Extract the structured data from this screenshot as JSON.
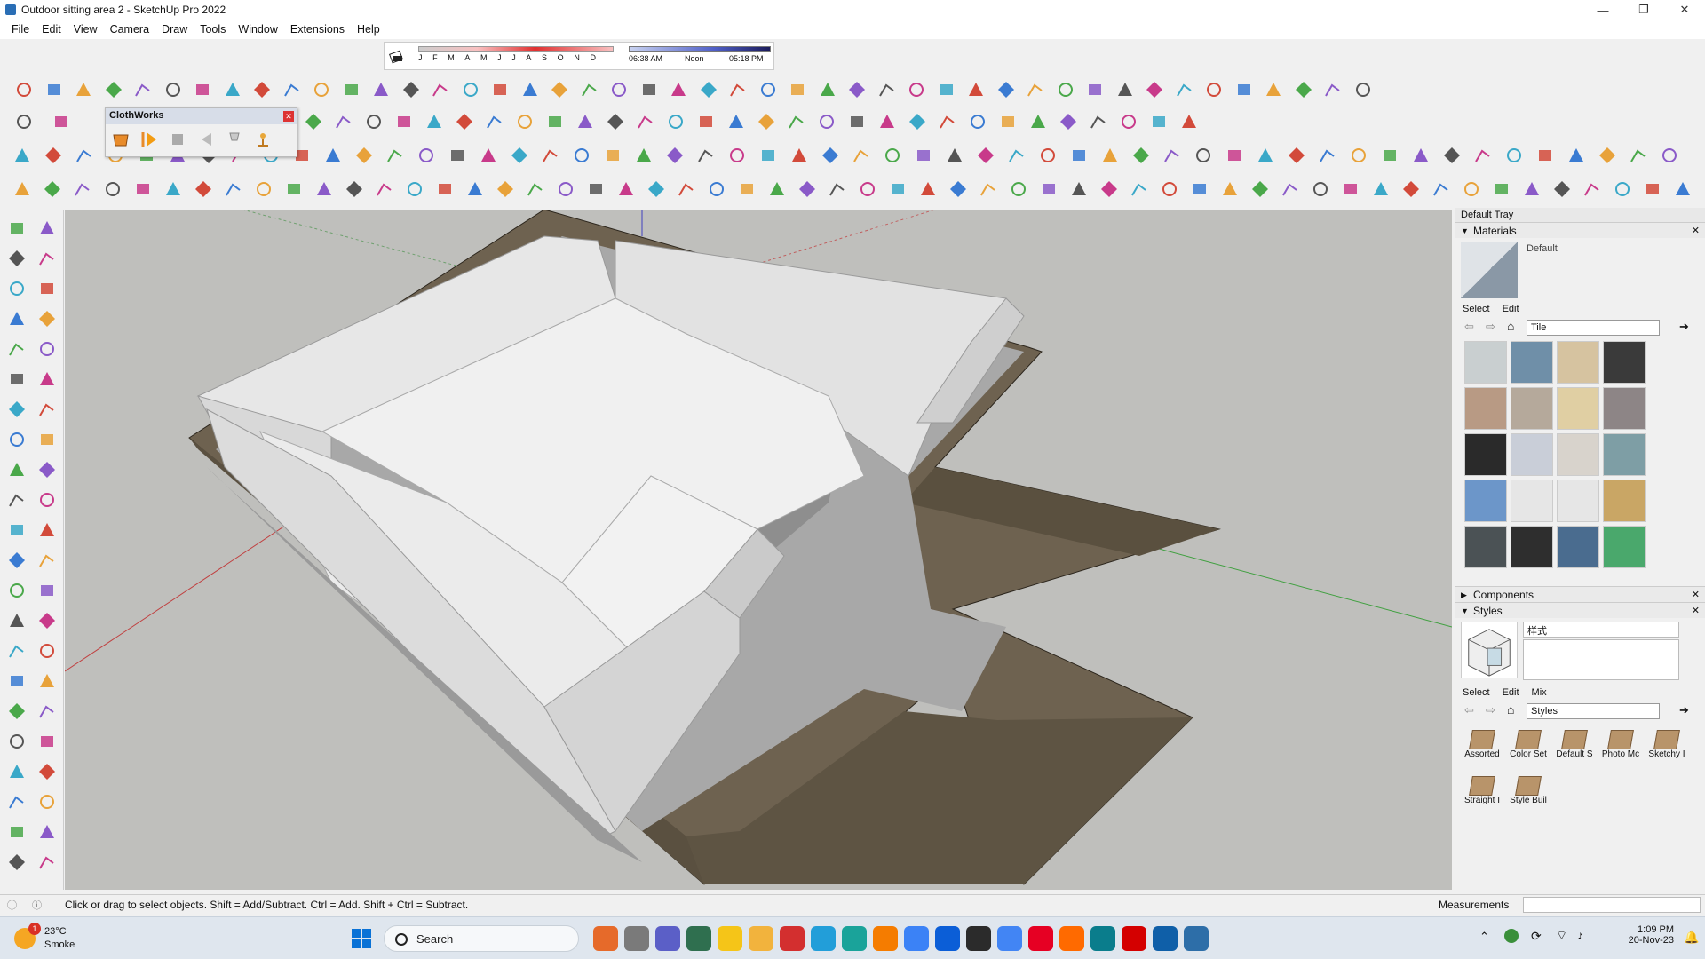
{
  "window": {
    "title": "Outdoor sitting area 2 - SketchUp Pro 2022",
    "controls": [
      "—",
      "❐",
      "✕"
    ]
  },
  "menu": [
    "File",
    "Edit",
    "View",
    "Camera",
    "Draw",
    "Tools",
    "Window",
    "Extensions",
    "Help"
  ],
  "shadows": {
    "months": [
      "J",
      "F",
      "M",
      "A",
      "M",
      "J",
      "J",
      "A",
      "S",
      "O",
      "N",
      "D"
    ],
    "time_start": "06:38 AM",
    "time_mid": "Noon",
    "time_end": "05:18 PM"
  },
  "clothworks": {
    "title": "ClothWorks",
    "close": "✕"
  },
  "tray": {
    "title": "Default Tray",
    "materials": {
      "header": "Materials",
      "current": "Default",
      "tabs": [
        "Select",
        "Edit"
      ],
      "library": "Tile",
      "swatch_colors": [
        "#c9cfd0",
        "#6f8fa8",
        "#d6c3a0",
        "#3a3a3a",
        "#b89a84",
        "#b5a99b",
        "#e0cfa3",
        "#8d8586",
        "#2a2a2a",
        "#c9ced8",
        "#d8d3cc",
        "#7e9ea5",
        "#6c96c9",
        "#e6e6e6",
        "#e6e6e6",
        "#c9a665",
        "#4b5255",
        "#2e2e2e",
        "#4a6c8f",
        "#4aa86c"
      ]
    },
    "components": {
      "header": "Components"
    },
    "styles": {
      "header": "Styles",
      "current": "样式",
      "tabs": [
        "Select",
        "Edit",
        "Mix"
      ],
      "library": "Styles",
      "items": [
        "Assorted",
        "Color Set",
        "Default S",
        "Photo Mc",
        "Sketchy I",
        "Straight I",
        "Style Buil"
      ]
    }
  },
  "status": {
    "hint": "Click or drag to select objects. Shift = Add/Subtract. Ctrl = Add. Shift + Ctrl = Subtract.",
    "measurements_label": "Measurements",
    "measurements_value": ""
  },
  "taskbar": {
    "weather_temp": "23°C",
    "weather_desc": "Smoke",
    "weather_badge": "1",
    "search_placeholder": "Search",
    "time": "1:09 PM",
    "date": "20-Nov-23",
    "colors": {
      "accent": "#0067c0"
    }
  }
}
